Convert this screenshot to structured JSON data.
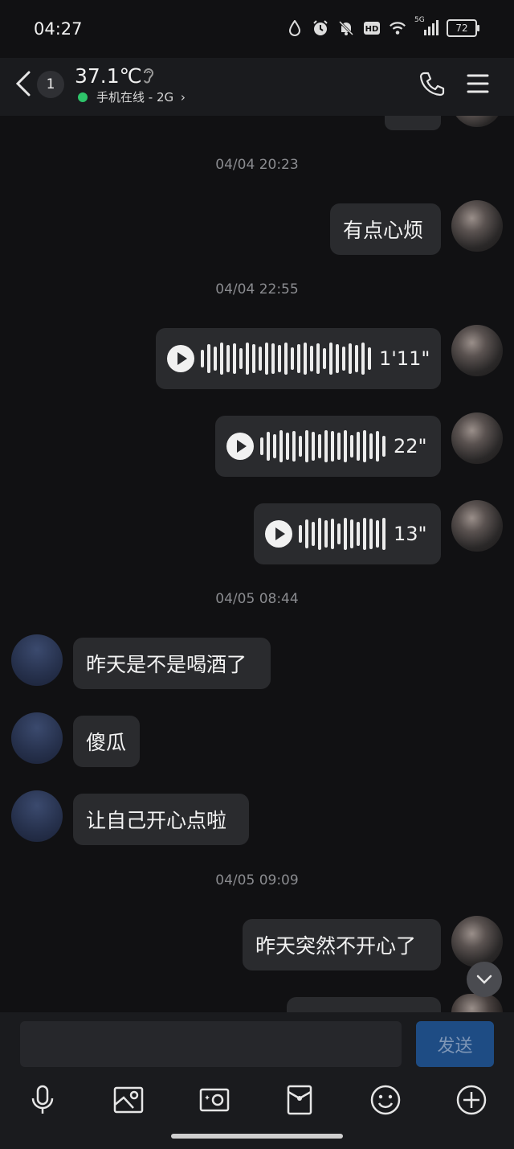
{
  "status_bar": {
    "time": "04:27",
    "battery": "72",
    "network": "5G",
    "hd": "HD",
    "icons": [
      "water-drop-icon",
      "alarm-icon",
      "mute-bell-icon",
      "hd-icon",
      "wifi-icon",
      "signal-icon",
      "battery-icon"
    ]
  },
  "header": {
    "unread_count": "1",
    "title": "37.1℃",
    "online_status": "手机在线 - 2G",
    "online_color": "#2ec46a"
  },
  "messages": [
    {
      "type": "timestamp",
      "text": "04/04 20:23"
    },
    {
      "type": "text",
      "from": "me",
      "text": "有点心烦"
    },
    {
      "type": "timestamp",
      "text": "04/04 22:55"
    },
    {
      "type": "voice",
      "from": "me",
      "duration": "1'11\""
    },
    {
      "type": "voice",
      "from": "me",
      "duration": "22\""
    },
    {
      "type": "voice",
      "from": "me",
      "duration": "13\""
    },
    {
      "type": "timestamp",
      "text": "04/05 08:44"
    },
    {
      "type": "text",
      "from": "them",
      "text": "昨天是不是喝酒了"
    },
    {
      "type": "text",
      "from": "them",
      "text": "傻瓜"
    },
    {
      "type": "text",
      "from": "them",
      "text": "让自己开心点啦"
    },
    {
      "type": "timestamp",
      "text": "04/05 09:09"
    },
    {
      "type": "text",
      "from": "me",
      "text": "昨天突然不开心了"
    }
  ],
  "input": {
    "placeholder": "",
    "value": "",
    "send_label": "发送"
  },
  "toolbar": [
    "microphone-icon",
    "image-icon",
    "camera-icon",
    "red-packet-icon",
    "emoji-icon",
    "plus-icon"
  ],
  "colors": {
    "background": "#111113",
    "bubble": "#2a2b2e",
    "send_button": "#1e4c84"
  }
}
